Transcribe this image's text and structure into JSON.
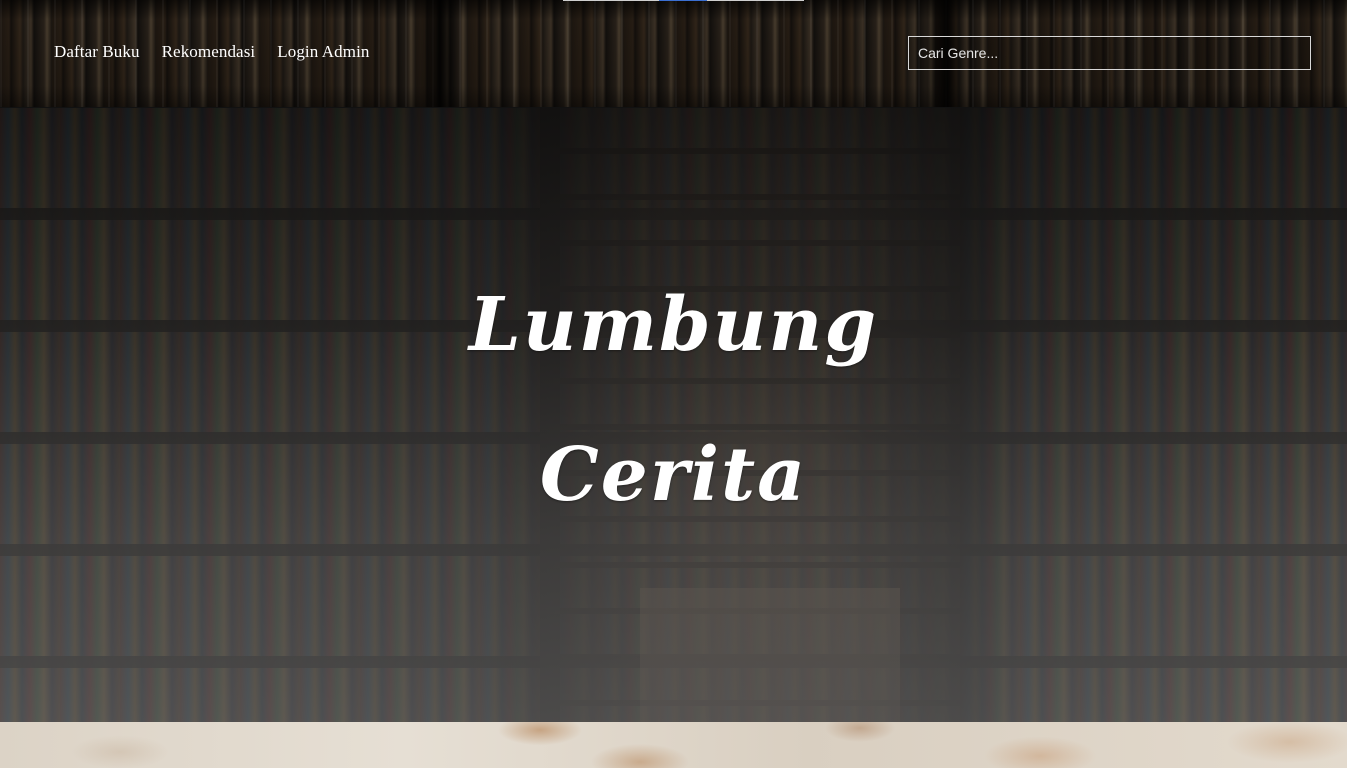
{
  "nav": {
    "links": [
      {
        "label": "Daftar Buku"
      },
      {
        "label": "Rekomendasi"
      },
      {
        "label": "Login Admin"
      }
    ],
    "search": {
      "placeholder": "Cari Genre...",
      "value": ""
    }
  },
  "hero": {
    "title_line_1": "Lumbung",
    "title_line_2": "Cerita"
  },
  "colors": {
    "nav_text": "#ffffff",
    "title_text": "#ffffff",
    "top_indicator_active": "#3b6fd1"
  }
}
